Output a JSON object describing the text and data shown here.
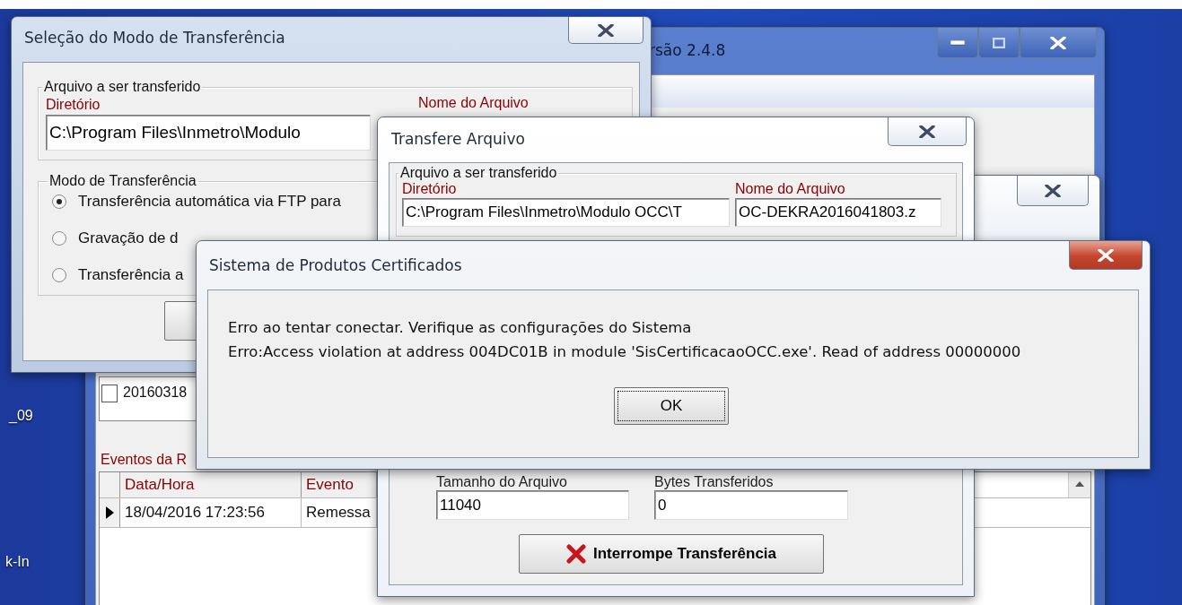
{
  "desktop": {
    "icon_labels": [
      "_09",
      "k-In"
    ]
  },
  "main_window": {
    "title": "rsão 2.4.8",
    "list_item": {
      "label": "20160318",
      "checked": false
    },
    "events_label": "Eventos da R",
    "events_table": {
      "columns": [
        "Data/Hora",
        "Evento"
      ],
      "rows": [
        {
          "cells": [
            "18/04/2016 17:23:56",
            "Remessa"
          ],
          "current": true
        }
      ]
    }
  },
  "selection_window": {
    "title": "Seleção do Modo de Transferência",
    "file_group": "Arquivo a ser transferido",
    "directory_label": "Diretório",
    "directory_value": "C:\\Program Files\\Inmetro\\Modulo",
    "filename_label": "Nome do Arquivo",
    "mode_group": "Modo de Transferência",
    "modes": [
      {
        "label": "Transferência automática via FTP para",
        "selected": true
      },
      {
        "label": "Gravação de d",
        "selected": false
      },
      {
        "label": "Transferência a",
        "selected": false
      }
    ]
  },
  "transfer_window": {
    "title": "Transfere Arquivo",
    "file_group": "Arquivo a ser transferido",
    "directory_label": "Diretório",
    "directory_value": "C:\\Program Files\\Inmetro\\Modulo OCC\\T",
    "filename_label": "Nome do Arquivo",
    "filename_value": "OC-DEKRA2016041803.z",
    "size_label": "Tamanho do Arquivo",
    "size_value": "11040",
    "bytes_label": "Bytes Transferidos",
    "bytes_value": "0",
    "stop_button": "Interrompe Transferência"
  },
  "error_dialog": {
    "title": "Sistema de Produtos Certificados",
    "lines": [
      "Erro ao tentar conectar. Verifique as configurações do Sistema",
      "Erro:Access violation at address 004DC01B in module 'SisCertificacaoOCC.exe'. Read of address 00000000"
    ],
    "ok_button": "OK"
  }
}
